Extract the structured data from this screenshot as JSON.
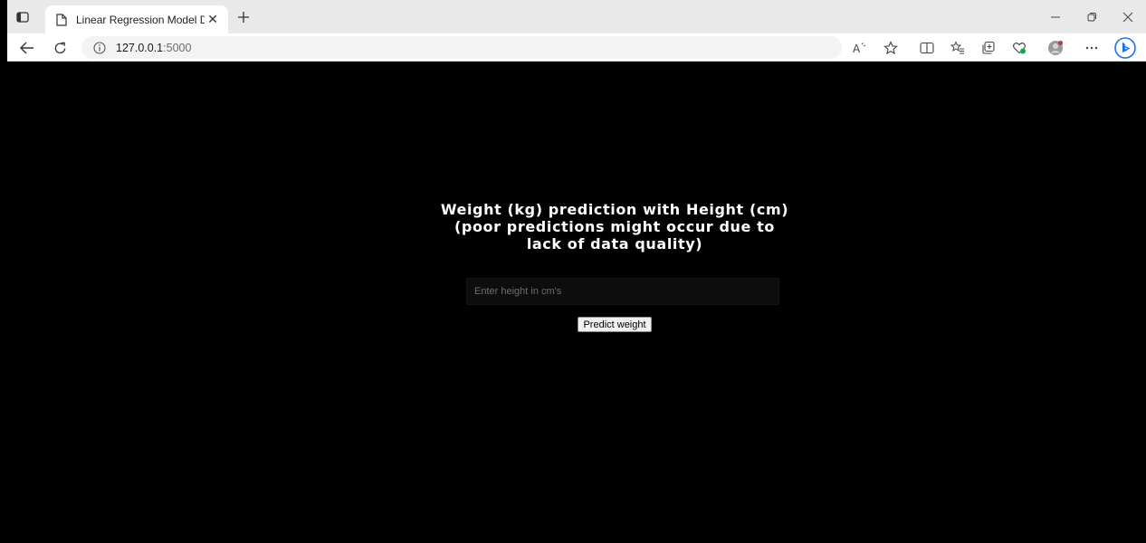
{
  "browser": {
    "tab": {
      "title": "Linear Regression Model Deploy"
    },
    "address": {
      "host": "127.0.0.1",
      "port": ":5000"
    },
    "icons": {
      "tab_actions": "tab-actions-icon",
      "favicon": "page-icon",
      "close": "close-icon",
      "new_tab": "plus-icon",
      "back": "back-arrow-icon",
      "refresh": "refresh-icon",
      "info": "info-icon",
      "read_aloud": "read-aloud-icon",
      "favorite": "star-icon",
      "split": "split-screen-icon",
      "favorites": "favorites-icon",
      "collections": "collections-icon",
      "performance": "heart-icon",
      "profile": "profile-icon",
      "more": "more-icon",
      "bing": "bing-icon"
    }
  },
  "page": {
    "heading": "Weight (kg) prediction with Height (cm) (poor predictions might occur due to lack of data quality)",
    "input": {
      "placeholder": "Enter height in cm's",
      "value": ""
    },
    "button": {
      "label": "Predict weight"
    }
  },
  "colors": {
    "page_bg": "#000000",
    "text": "#ffffff",
    "bing_accent": "#1a73e8"
  }
}
